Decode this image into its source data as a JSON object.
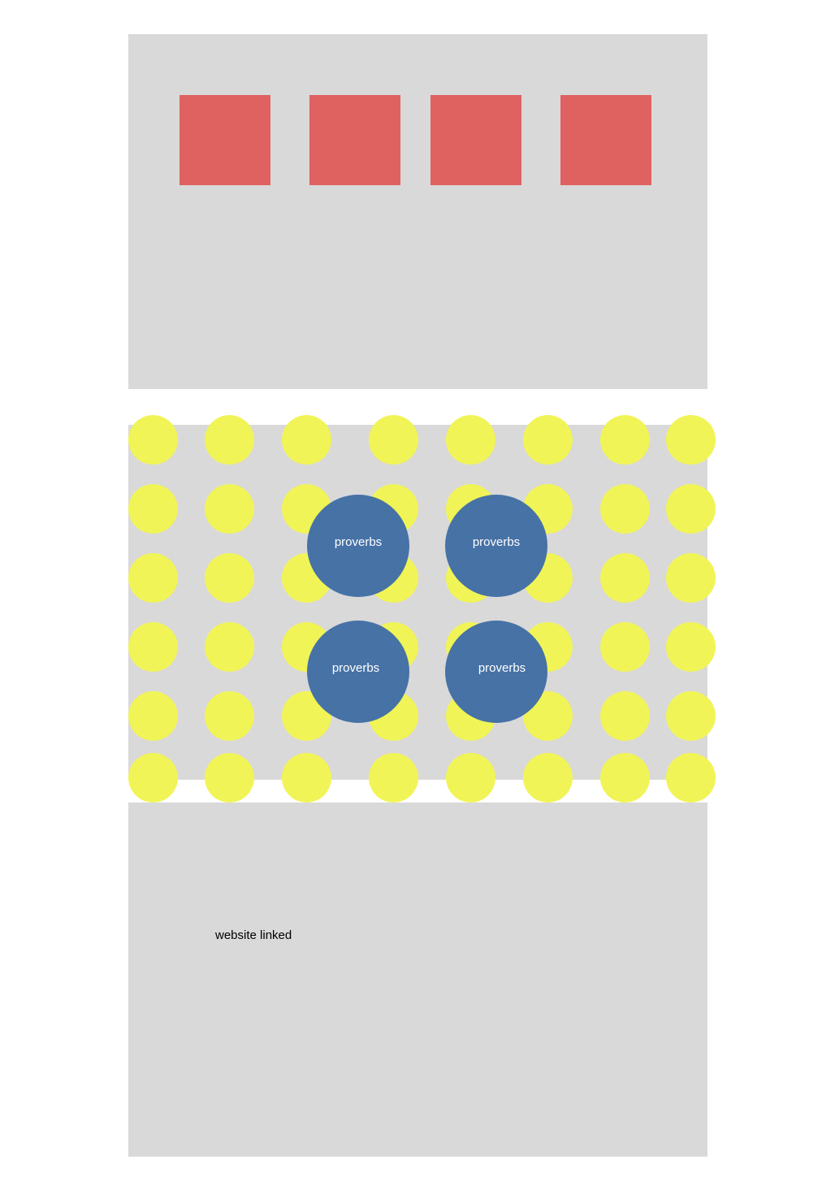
{
  "colors": {
    "panel": "#d9d9d9",
    "red_square": "#df6260",
    "yellow_dot": "#f1f456",
    "blue_circle": "#4672a6",
    "background": "#ffffff"
  },
  "circles": [
    {
      "label": "proverbs"
    },
    {
      "label": "proverbs"
    },
    {
      "label": "proverbs"
    },
    {
      "label": "proverbs"
    }
  ],
  "footer": {
    "link_text": "website linked"
  }
}
